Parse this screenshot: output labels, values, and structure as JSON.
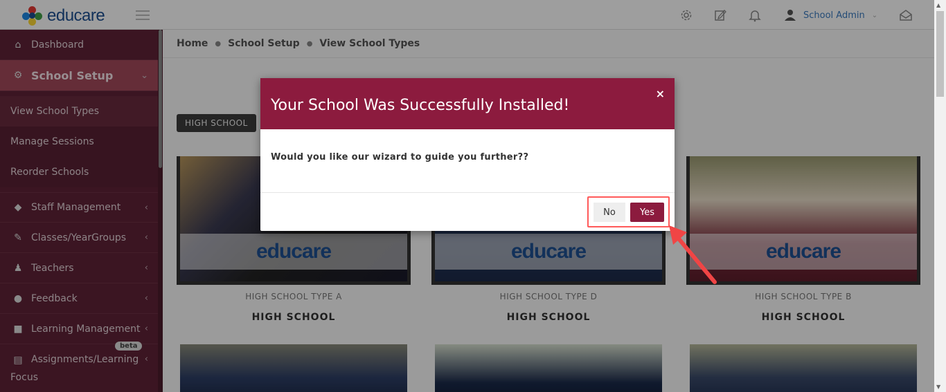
{
  "app": {
    "brand": "educare"
  },
  "topbar": {
    "user_name": "School Admin",
    "icons": [
      "gear-icon",
      "edit-icon",
      "bell-icon",
      "user-icon",
      "mail-icon"
    ]
  },
  "sidebar": {
    "items": [
      {
        "label": "Dashboard",
        "icon": "home-icon"
      },
      {
        "label": "School Setup",
        "icon": "gear-icon"
      },
      {
        "label": "View School Types"
      },
      {
        "label": "Manage Sessions"
      },
      {
        "label": "Reorder Schools"
      },
      {
        "label": "Staff Management",
        "icon": "diamond-icon"
      },
      {
        "label": "Classes/YearGroups",
        "icon": "edit-icon"
      },
      {
        "label": "Teachers",
        "icon": "teacher-icon"
      },
      {
        "label": "Feedback",
        "icon": "chat-icon"
      },
      {
        "label": "Learning Management",
        "icon": "folder-icon"
      },
      {
        "label": "Assignments/Learning",
        "label2": "Focus",
        "icon": "book-icon",
        "badge": "beta"
      }
    ]
  },
  "breadcrumb": [
    "Home",
    "School Setup",
    "View School Types"
  ],
  "main": {
    "filter_tag": "HIGH SCHOOL",
    "cards": [
      {
        "type": "HIGH SCHOOL TYPE A",
        "name": "HIGH SCHOOL"
      },
      {
        "type": "HIGH SCHOOL TYPE D",
        "name": "HIGH SCHOOL"
      },
      {
        "type": "HIGH SCHOOL TYPE B",
        "name": "HIGH SCHOOL"
      }
    ],
    "card_logo": "educare"
  },
  "modal": {
    "title": "Your School Was Successfully Installed!",
    "close": "×",
    "question": "Would you like our wizard to guide you further??",
    "no_label": "No",
    "yes_label": "Yes"
  },
  "colors": {
    "brand": "#8c1b3e",
    "sidebar": "#5f2337",
    "active": "#a4495b",
    "logo_blue": "#1d4f91"
  }
}
